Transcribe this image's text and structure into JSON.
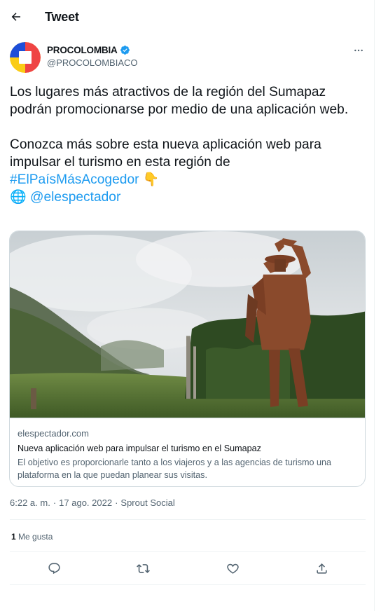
{
  "header": {
    "title": "Tweet",
    "back_icon": "arrow-left-icon"
  },
  "author": {
    "display_name": "PROCOLOMBIA",
    "handle": "@PROCOLOMBIACO",
    "verified": true,
    "avatar_colors": [
      "#1d4ed8",
      "#ef4444",
      "#facc15"
    ],
    "more_icon": "more-horizontal-icon"
  },
  "tweet": {
    "paragraph1": "Los lugares más atractivos de la región del Sumapaz podrán promocionarse por medio de una aplicación web.",
    "paragraph2": "Conozca más sobre esta nueva aplicación web para impulsar el turismo en esta región de",
    "hashtag": "#ElPaísMásAcogedor",
    "pointing_emoji": "👇",
    "globe_emoji": "🌐",
    "mention": "@elespectador"
  },
  "card": {
    "domain": "elespectador.com",
    "title": "Nueva aplicación web para impulsar el turismo en el Sumapaz",
    "description": "El objetivo es proporcionarle tanto a los viajeros y a las agencias de turismo una plataforma en la que puedan planear sus visitas."
  },
  "meta": {
    "time": "6:22 a. m.",
    "separator": "·",
    "date": "17 ago. 2022",
    "source": "Sprout Social"
  },
  "stats": {
    "likes_count": "1",
    "likes_label": "Me gusta"
  },
  "actions": [
    {
      "name": "reply",
      "icon": "reply-icon"
    },
    {
      "name": "retweet",
      "icon": "retweet-icon"
    },
    {
      "name": "like",
      "icon": "heart-icon"
    },
    {
      "name": "share",
      "icon": "share-icon"
    }
  ],
  "colors": {
    "link": "#1d9bf0",
    "text": "#0f1419",
    "secondary": "#536471",
    "border": "#cfd9de"
  }
}
